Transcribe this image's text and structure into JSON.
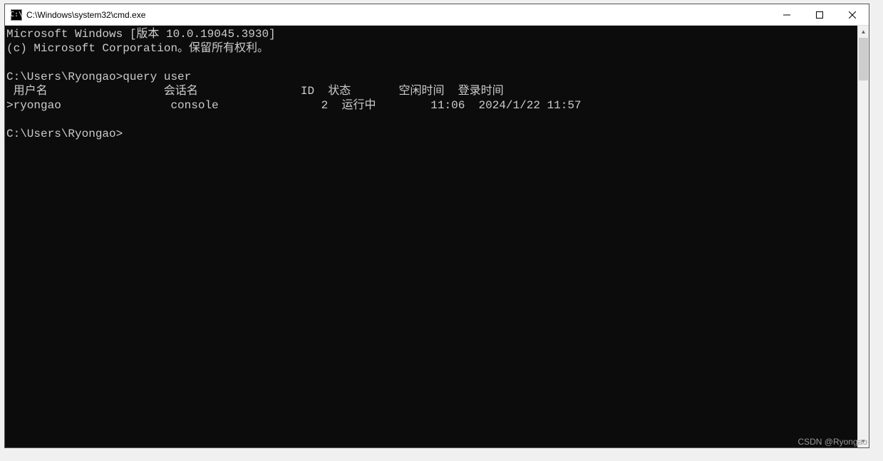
{
  "window": {
    "title": "C:\\Windows\\system32\\cmd.exe",
    "icon_label": "C:\\"
  },
  "terminal": {
    "banner_line1": "Microsoft Windows [版本 10.0.19045.3930]",
    "banner_line2": "(c) Microsoft Corporation。保留所有权利。",
    "prompt1_path": "C:\\Users\\Ryongao>",
    "prompt1_command": "query user",
    "header": {
      "username": " 用户名",
      "sessionname": "会话名",
      "id": "ID",
      "state": "状态",
      "idle_time": "空闲时间",
      "logon_time": "登录时间"
    },
    "row": {
      "marker": ">",
      "username": "ryongao",
      "sessionname": "console",
      "id": "2",
      "state": "运行中",
      "idle_time": "11:06",
      "logon_time": "2024/1/22 11:57"
    },
    "prompt2_path": "C:\\Users\\Ryongao>"
  },
  "watermark": "CSDN @Ryongao"
}
